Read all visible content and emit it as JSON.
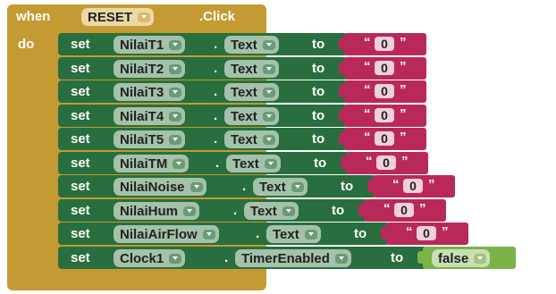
{
  "event": {
    "when_label": "when",
    "component": "RESET",
    "event_name": ".Click",
    "do_label": "do"
  },
  "statements": [
    {
      "set_label": "set",
      "component": "NilaiT1",
      "dot": ".",
      "property": "Text",
      "to_label": "to",
      "value": "0",
      "value_type": "text"
    },
    {
      "set_label": "set",
      "component": "NilaiT2",
      "dot": ".",
      "property": "Text",
      "to_label": "to",
      "value": "0",
      "value_type": "text"
    },
    {
      "set_label": "set",
      "component": "NilaiT3",
      "dot": ".",
      "property": "Text",
      "to_label": "to",
      "value": "0",
      "value_type": "text"
    },
    {
      "set_label": "set",
      "component": "NilaiT4",
      "dot": ".",
      "property": "Text",
      "to_label": "to",
      "value": "0",
      "value_type": "text"
    },
    {
      "set_label": "set",
      "component": "NilaiT5",
      "dot": ".",
      "property": "Text",
      "to_label": "to",
      "value": "0",
      "value_type": "text"
    },
    {
      "set_label": "set",
      "component": "NilaiTM",
      "dot": ".",
      "property": "Text",
      "to_label": "to",
      "value": "0",
      "value_type": "text"
    },
    {
      "set_label": "set",
      "component": "NilaiNoise",
      "dot": ".",
      "property": "Text",
      "to_label": "to",
      "value": "0",
      "value_type": "text"
    },
    {
      "set_label": "set",
      "component": "NilaiHum",
      "dot": ".",
      "property": "Text",
      "to_label": "to",
      "value": "0",
      "value_type": "text"
    },
    {
      "set_label": "set",
      "component": "NilaiAirFlow",
      "dot": ".",
      "property": "Text",
      "to_label": "to",
      "value": "0",
      "value_type": "text"
    },
    {
      "set_label": "set",
      "component": "Clock1",
      "dot": ".",
      "property": "TimerEnabled",
      "to_label": "to",
      "value": "false",
      "value_type": "boolean"
    }
  ],
  "quote_open": "“",
  "quote_close": "”",
  "colors": {
    "event_block": "#c49a33",
    "setter_block": "#286e3e",
    "text_block": "#b8295a",
    "logic_block": "#7bb24a"
  }
}
